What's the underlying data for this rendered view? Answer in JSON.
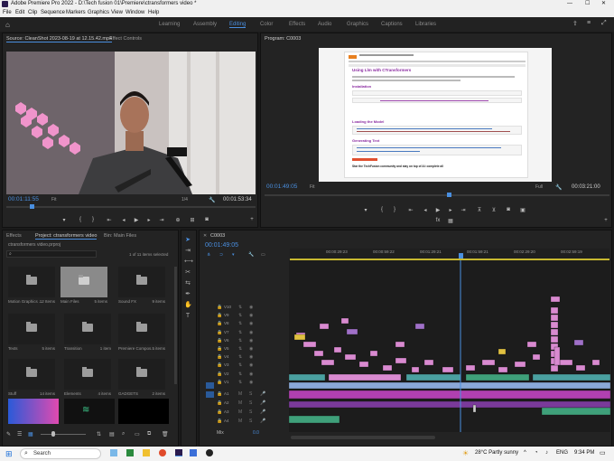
{
  "app": {
    "title": "Adobe Premiere Pro 2022 - D:\\Tech fusion 01\\Premiere\\ctransformers video *"
  },
  "menu": [
    "File",
    "Edit",
    "Clip",
    "Sequence",
    "Markers",
    "Graphics",
    "View",
    "Window",
    "Help"
  ],
  "workspaces": [
    "Learning",
    "Assembly",
    "Editing",
    "Color",
    "Effects",
    "Audio",
    "Graphics",
    "Captions",
    "Libraries"
  ],
  "active_workspace": "Editing",
  "source": {
    "tab": "Source: CleanShot 2023-08-19 at 12.15.42.mp4",
    "tab2": "Effect Controls",
    "timecode": "00:01:11:55",
    "fit": "Fit",
    "fraction": "1/4",
    "duration": "00:01:53:34"
  },
  "program": {
    "tab": "Program: C0003",
    "timecode": "00:01:49:05",
    "fit": "Fit",
    "quality": "Full",
    "duration": "00:03:21:00"
  },
  "project": {
    "tab_effects": "Effects",
    "tab": "Project: ctransformers video",
    "tab_bin": "Bin: Main Files",
    "file": "ctransformers video.prproj",
    "selected": "1 of 11 items selected",
    "items": [
      {
        "name": "Motion Graphics ...",
        "count": "12 Items"
      },
      {
        "name": "Main Files",
        "count": "5 items"
      },
      {
        "name": "Sound FX",
        "count": "9 items"
      },
      {
        "name": "Texts",
        "count": "5 items"
      },
      {
        "name": "Transition",
        "count": "1 item"
      },
      {
        "name": "Premiere Compos...",
        "count": "5 items"
      },
      {
        "name": "Stuff",
        "count": "14 items"
      },
      {
        "name": "Elements",
        "count": "4 items"
      },
      {
        "name": "GADGETS",
        "count": "2 items"
      }
    ]
  },
  "timeline": {
    "tab": "C0003",
    "timecode": "00:01:49:05",
    "ruler": [
      "00:00:29:23",
      "00:00:59:22",
      "00:01:29:21",
      "00:01:59:21",
      "00:02:29:20",
      "00:02:59:19"
    ],
    "video_tracks": [
      "V10",
      "V9",
      "V8",
      "V7",
      "V6",
      "V5",
      "V4",
      "V3",
      "V2",
      "V1"
    ],
    "audio_tracks": [
      "A1",
      "A2",
      "A3",
      "A4"
    ],
    "mix": "Mix",
    "mix_value": "0.0"
  },
  "notebook": {
    "title": "Using Llm with CTransformers",
    "h_install": "Installation",
    "h_load": "Loading the Model",
    "h_gen": "Generating Text",
    "footer": "Star the TechFusion community and stay on top of AI: complete all"
  },
  "taskbar": {
    "search": "Search",
    "weather": "28°C  Partly sunny",
    "lang": "ENG",
    "time": "9:34 PM"
  },
  "colors": {
    "accent": "#4a8fe0",
    "pink": "#d98ad0",
    "magenta": "#b040b0",
    "green": "#3fa07a",
    "teal": "#4aa0a0",
    "blue_clip": "#8aa8d8",
    "purple": "#a070c8",
    "yellow": "#e0c040"
  }
}
